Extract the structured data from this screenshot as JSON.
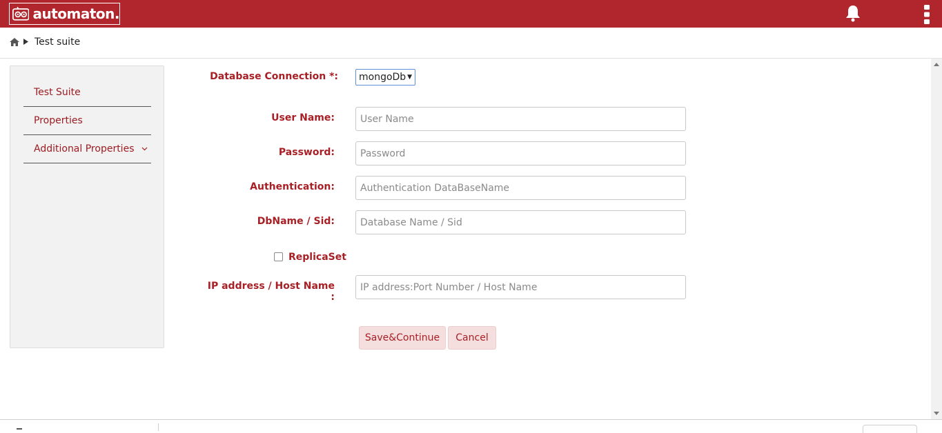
{
  "app": {
    "name": "automaton."
  },
  "breadcrumb": {
    "current": "Test suite"
  },
  "sidebar": {
    "items": [
      {
        "label": "Test Suite"
      },
      {
        "label": "Properties"
      },
      {
        "label": "Additional Properties"
      }
    ]
  },
  "form": {
    "db_connection": {
      "label": "Database Connection *:",
      "value": "mongoDb"
    },
    "username": {
      "label": "User Name:",
      "placeholder": "User Name",
      "value": ""
    },
    "password": {
      "label": "Password:",
      "placeholder": "Password",
      "value": ""
    },
    "authentication": {
      "label": "Authentication:",
      "placeholder": "Authentication DataBaseName",
      "value": ""
    },
    "dbname": {
      "label": "DbName / Sid:",
      "placeholder": "Database Name / Sid",
      "value": ""
    },
    "replicaset": {
      "label": "ReplicaSet",
      "checked": false
    },
    "host": {
      "label": "IP address / Host Name :",
      "placeholder": "IP address:Port Number / Host Name",
      "value": ""
    }
  },
  "actions": {
    "save_label": "Save&Continue",
    "cancel_label": "Cancel"
  },
  "colors": {
    "brand": "#b0262c",
    "label": "#a81f25",
    "button_bg": "#f5dede"
  },
  "icons": {
    "bell": "bell-icon",
    "menu": "kebab-menu-icon",
    "home": "home-icon"
  }
}
